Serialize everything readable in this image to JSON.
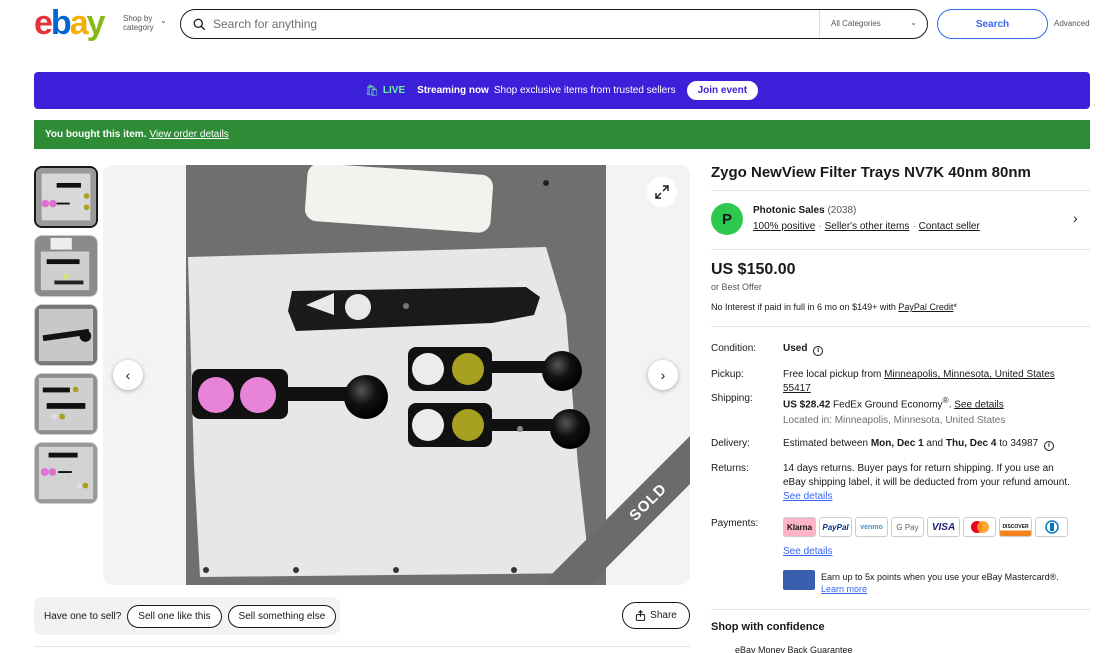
{
  "header": {
    "logo_letters": [
      "e",
      "b",
      "a",
      "y"
    ],
    "logo_colors": [
      "#e53238",
      "#0064d2",
      "#f5af02",
      "#86b817"
    ],
    "shop_by_label": "Shop by category",
    "search_placeholder": "Search for anything",
    "category_selected": "All Categories",
    "search_button": "Search",
    "advanced_link": "Advanced"
  },
  "live_banner": {
    "live_label": "LIVE",
    "streaming": "Streaming now",
    "text": "Shop exclusive items from trusted sellers",
    "join_button": "Join event",
    "bg_color": "#3c1fd8"
  },
  "bought_bar": {
    "text": "You bought this item.",
    "link": "View order details",
    "bg_color": "#2e8b36"
  },
  "gallery": {
    "thumbnail_count": 5,
    "sold_label": "SOLD"
  },
  "sell_bar": {
    "question": "Have one to sell?",
    "sell_like_this": "Sell one like this",
    "sell_else": "Sell something else"
  },
  "share_label": "Share",
  "listing": {
    "title": "Zygo NewView Filter Trays NV7K 40nm 80nm",
    "seller": {
      "initial": "P",
      "name": "Photonic Sales",
      "feedback_count": "(2038)",
      "positive": "100% positive",
      "other_items": "Seller's other items",
      "contact": "Contact seller"
    },
    "price": "US $150.00",
    "best_offer": "or Best Offer",
    "financing_prefix": "No Interest if paid in full in 6 mo on $149+ with",
    "financing_link": "PayPal Credit",
    "financing_suffix": "*"
  },
  "specs": {
    "condition_label": "Condition:",
    "condition_value": "Used",
    "pickup_label": "Pickup:",
    "pickup_prefix": "Free local pickup from",
    "pickup_location": "Minneapolis, Minnesota, United States 55417",
    "shipping_label": "Shipping:",
    "shipping_price": "US $28.42",
    "shipping_method": "FedEx Ground Economy",
    "shipping_sup": "®",
    "shipping_details": "See details",
    "located_in": "Located in: Minneapolis, Minnesota, United States",
    "delivery_label": "Delivery:",
    "delivery_prefix": "Estimated between",
    "delivery_start": "Mon, Dec 1",
    "delivery_and": "and",
    "delivery_end": "Thu, Dec 4",
    "delivery_to": "to 34987",
    "returns_label": "Returns:",
    "returns_text": "14 days returns. Buyer pays for return shipping. If you use an eBay shipping label, it will be deducted from your refund amount.",
    "returns_details": "See details",
    "payments_label": "Payments:",
    "payment_methods": [
      "Klarna",
      "PayPal",
      "venmo",
      "G Pay",
      "VISA",
      "MC",
      "DISCOVER",
      "Diners"
    ],
    "payments_details": "See details",
    "mastercard_promo": "Earn up to 5x points when you use your eBay Mastercard®.",
    "learn_more": "Learn more"
  },
  "confidence": {
    "heading": "Shop with confidence",
    "guarantee": "eBay Money Back Guarantee"
  }
}
